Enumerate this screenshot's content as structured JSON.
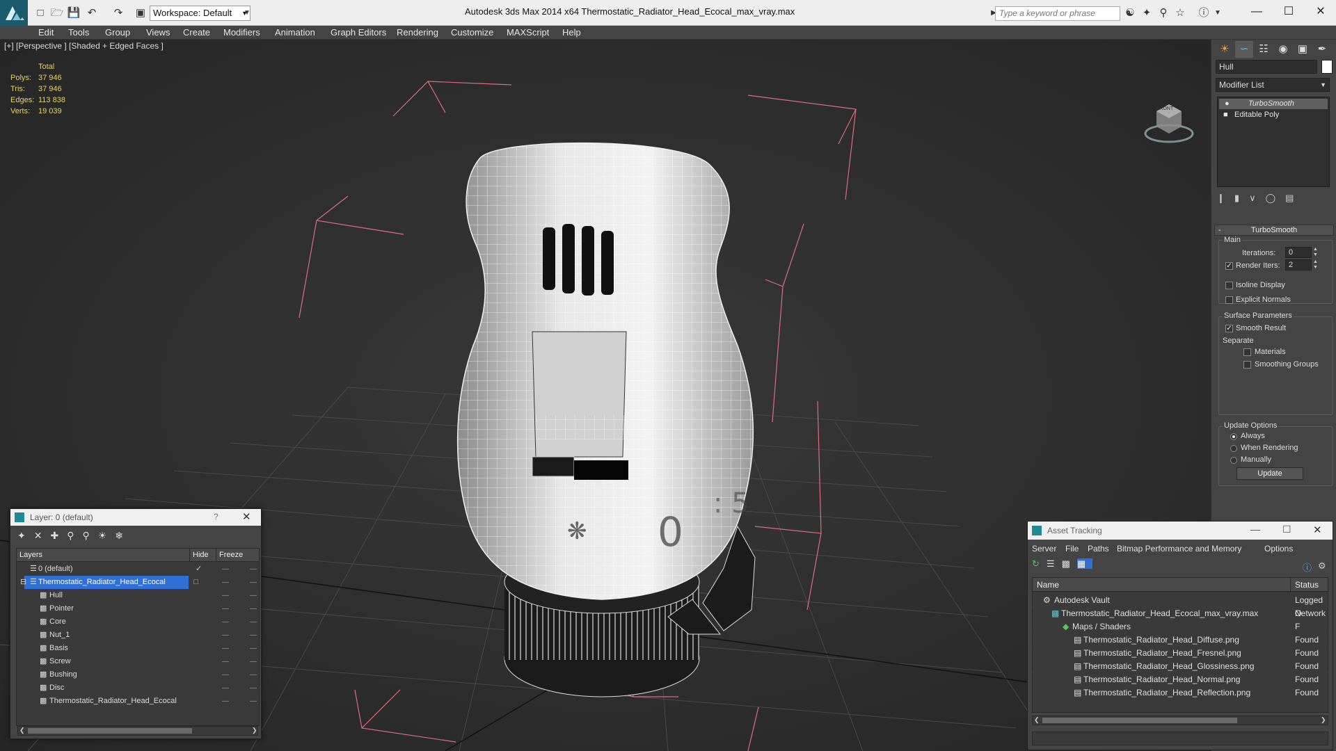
{
  "app": {
    "title": "Autodesk 3ds Max  2014 x64       Thermostatic_Radiator_Head_Ecocal_max_vray.max",
    "workspace": "Workspace: Default",
    "search_placeholder": "Type a keyword or phrase"
  },
  "menu": [
    "Edit",
    "Tools",
    "Group",
    "Views",
    "Create",
    "Modifiers",
    "Animation",
    "Graph Editors",
    "Rendering",
    "Customize",
    "MAXScript",
    "Help"
  ],
  "viewport": {
    "label": "[+] [Perspective ] [Shaded + Edged Faces ]",
    "stats": {
      "header": "Total",
      "rows": [
        {
          "k": "Polys:",
          "v": "37 946"
        },
        {
          "k": "Tris:",
          "v": "37 946"
        },
        {
          "k": "Edges:",
          "v": "113 838"
        },
        {
          "k": "Verts:",
          "v": "19 039"
        }
      ]
    },
    "viewcube_label": "FRONT"
  },
  "command_panel": {
    "object_name": "Hull",
    "modifier_list": "Modifier List",
    "stack": [
      "TurboSmooth",
      "Editable Poly"
    ],
    "rollout_title": "TurboSmooth",
    "main_label": "Main",
    "iterations_label": "Iterations:",
    "iterations_value": "0",
    "render_iters_label": "Render Iters:",
    "render_iters_value": "2",
    "isoline": "Isoline Display",
    "explicit_normals": "Explicit Normals",
    "surface_params": "Surface Parameters",
    "smooth_result": "Smooth Result",
    "separate": "Separate",
    "materials": "Materials",
    "smoothing_groups": "Smoothing Groups",
    "update_options": "Update Options",
    "always": "Always",
    "when_rendering": "When Rendering",
    "manually": "Manually",
    "update_btn": "Update"
  },
  "layer_dialog": {
    "title": "Layer: 0 (default)",
    "help": "?",
    "col_layers": "Layers",
    "col_hide": "Hide",
    "col_freeze": "Freeze",
    "rows": [
      {
        "name": "0 (default)",
        "indent": 0
      },
      {
        "name": "Thermostatic_Radiator_Head_Ecocal",
        "indent": 0,
        "selected": true
      },
      {
        "name": "Hull",
        "indent": 1
      },
      {
        "name": "Pointer",
        "indent": 1
      },
      {
        "name": "Core",
        "indent": 1
      },
      {
        "name": "Nut_1",
        "indent": 1
      },
      {
        "name": "Basis",
        "indent": 1
      },
      {
        "name": "Screw",
        "indent": 1
      },
      {
        "name": "Bushing",
        "indent": 1
      },
      {
        "name": "Disc",
        "indent": 1
      },
      {
        "name": "Thermostatic_Radiator_Head_Ecocal",
        "indent": 1
      }
    ]
  },
  "asset_dialog": {
    "title": "Asset Tracking",
    "menu": [
      "Server",
      "File",
      "Paths",
      "Bitmap Performance and Memory",
      "Options"
    ],
    "col_name": "Name",
    "col_status": "Status",
    "rows": [
      {
        "name": "Autodesk Vault",
        "status": "Logged O",
        "indent": 1
      },
      {
        "name": "Thermostatic_Radiator_Head_Ecocal_max_vray.max",
        "status": "Network F",
        "indent": 2
      },
      {
        "name": "Maps / Shaders",
        "status": "",
        "indent": 3
      },
      {
        "name": "Thermostatic_Radiator_Head_Diffuse.png",
        "status": "Found",
        "indent": 4
      },
      {
        "name": "Thermostatic_Radiator_Head_Fresnel.png",
        "status": "Found",
        "indent": 4
      },
      {
        "name": "Thermostatic_Radiator_Head_Glossiness.png",
        "status": "Found",
        "indent": 4
      },
      {
        "name": "Thermostatic_Radiator_Head_Normal.png",
        "status": "Found",
        "indent": 4
      },
      {
        "name": "Thermostatic_Radiator_Head_Reflection.png",
        "status": "Found",
        "indent": 4
      }
    ]
  },
  "colors": {
    "selection": "#2f6fd6",
    "stats_text": "#e8d35a",
    "bbox_lines": "#e06a8a"
  }
}
